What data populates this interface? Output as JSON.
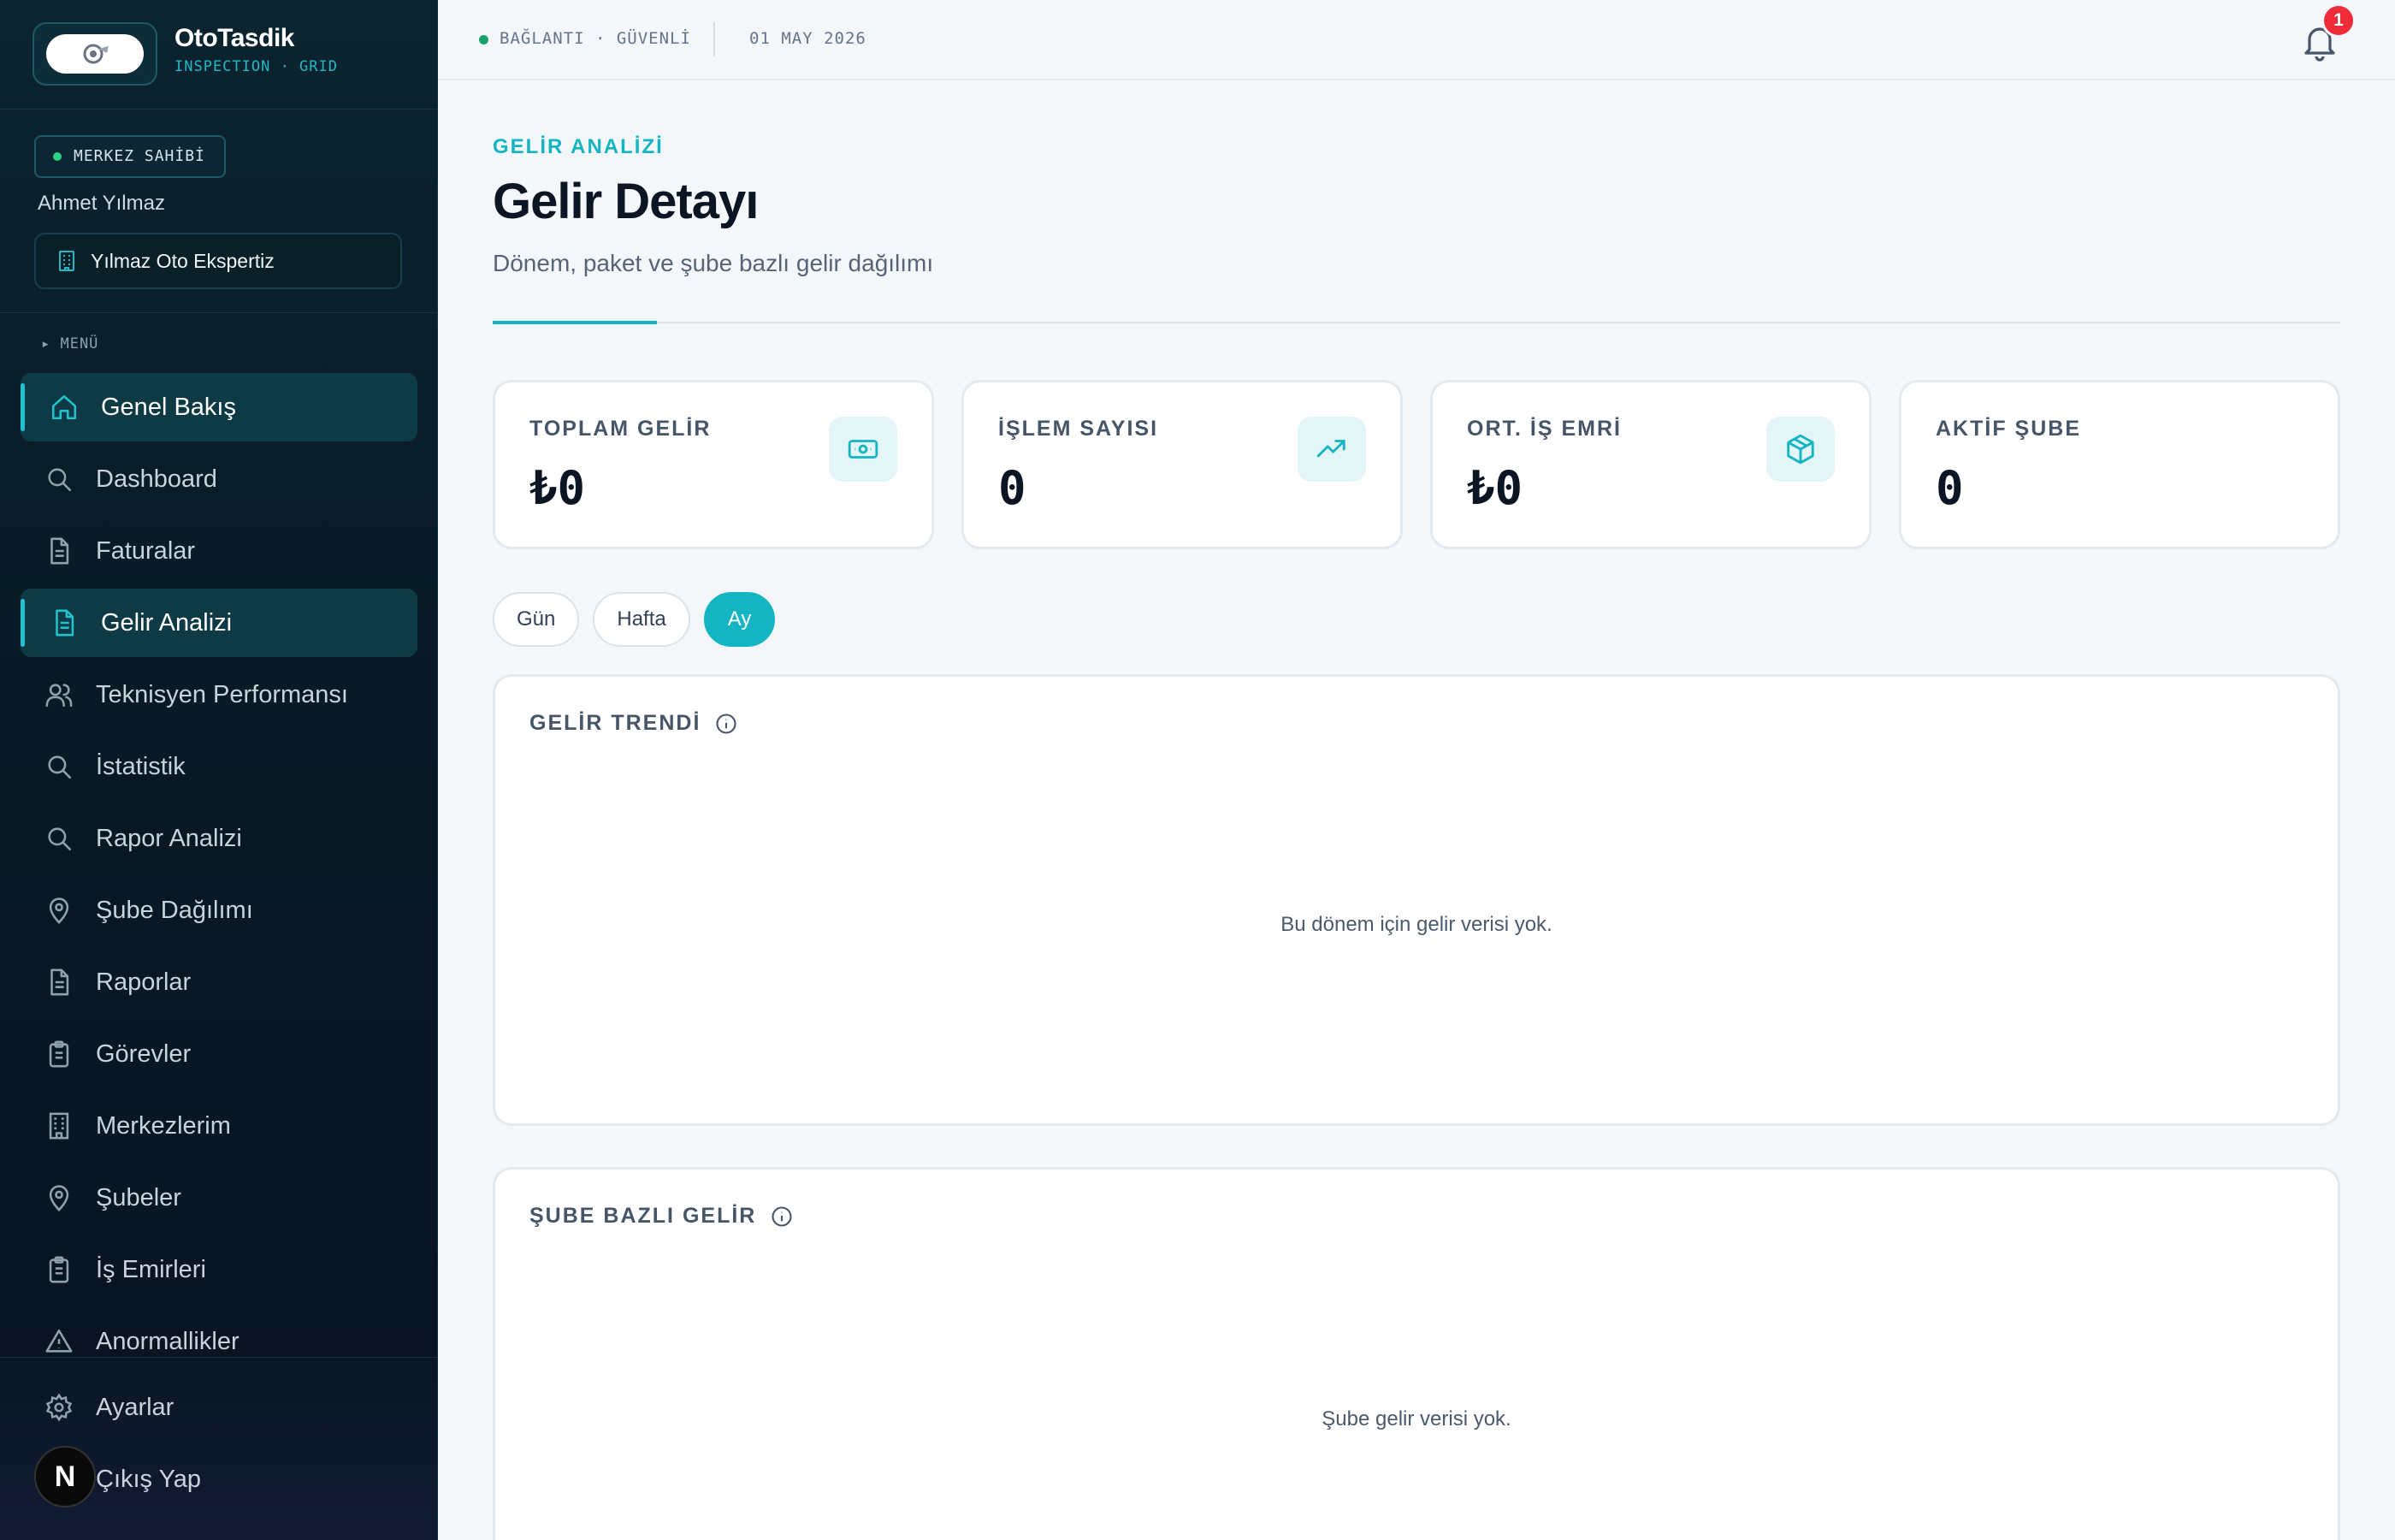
{
  "brand": {
    "name": "OtoTasdik",
    "subtitle": "INSPECTION · GRID"
  },
  "user": {
    "role_badge": "MERKEZ SAHİBİ",
    "name": "Ahmet Yılmaz",
    "organization": "Yılmaz Oto Ekspertiz"
  },
  "sidebar": {
    "menu_label": "▸ MENÜ",
    "items": [
      {
        "label": "Genel Bakış",
        "icon": "home-icon",
        "active": true
      },
      {
        "label": "Dashboard",
        "icon": "search-icon"
      },
      {
        "label": "Faturalar",
        "icon": "document-icon"
      },
      {
        "label": "Gelir Analizi",
        "icon": "document-icon",
        "active": true
      },
      {
        "label": "Teknisyen Performansı",
        "icon": "users-icon"
      },
      {
        "label": "İstatistik",
        "icon": "search-icon"
      },
      {
        "label": "Rapor Analizi",
        "icon": "search-icon"
      },
      {
        "label": "Şube Dağılımı",
        "icon": "map-pin-icon"
      },
      {
        "label": "Raporlar",
        "icon": "document-icon"
      },
      {
        "label": "Görevler",
        "icon": "clipboard-icon"
      },
      {
        "label": "Merkezlerim",
        "icon": "building-icon"
      },
      {
        "label": "Şubeler",
        "icon": "map-pin-icon"
      },
      {
        "label": "İş Emirleri",
        "icon": "clipboard-icon"
      },
      {
        "label": "Anormallikler",
        "icon": "warning-icon"
      }
    ],
    "bottom": [
      {
        "label": "Ayarlar",
        "icon": "gear-icon"
      },
      {
        "label": "Çıkış Yap",
        "icon": "logout-icon"
      }
    ],
    "fab_letter": "N"
  },
  "topbar": {
    "connection": "BAĞLANTI · GÜVENLİ",
    "date": "01 MAY 2026",
    "notification_count": "1"
  },
  "header": {
    "eyebrow": "GELİR ANALİZİ",
    "title": "Gelir Detayı",
    "subtitle": "Dönem, paket ve şube bazlı gelir dağılımı"
  },
  "kpis": [
    {
      "label": "TOPLAM GELİR",
      "value": "₺0",
      "icon": "cash-icon"
    },
    {
      "label": "İŞLEM SAYISI",
      "value": "0",
      "icon": "trend-up-icon"
    },
    {
      "label": "ORT. İŞ EMRİ",
      "value": "₺0",
      "icon": "box-icon"
    },
    {
      "label": "AKTİF ŞUBE",
      "value": "0"
    }
  ],
  "period_tabs": {
    "options": [
      "Gün",
      "Hafta",
      "Ay"
    ],
    "selected": "Ay"
  },
  "panels": {
    "trend": {
      "title": "GELİR TRENDİ",
      "empty": "Bu dönem için gelir verisi yok."
    },
    "branch": {
      "title": "ŞUBE BAZLI GELİR",
      "empty": "Şube gelir verisi yok."
    }
  },
  "colors": {
    "accent": "#14b4c3",
    "sidebar_bg": "#0b2430",
    "badge_red": "#ef2b3a",
    "status_green": "#16a36a"
  }
}
